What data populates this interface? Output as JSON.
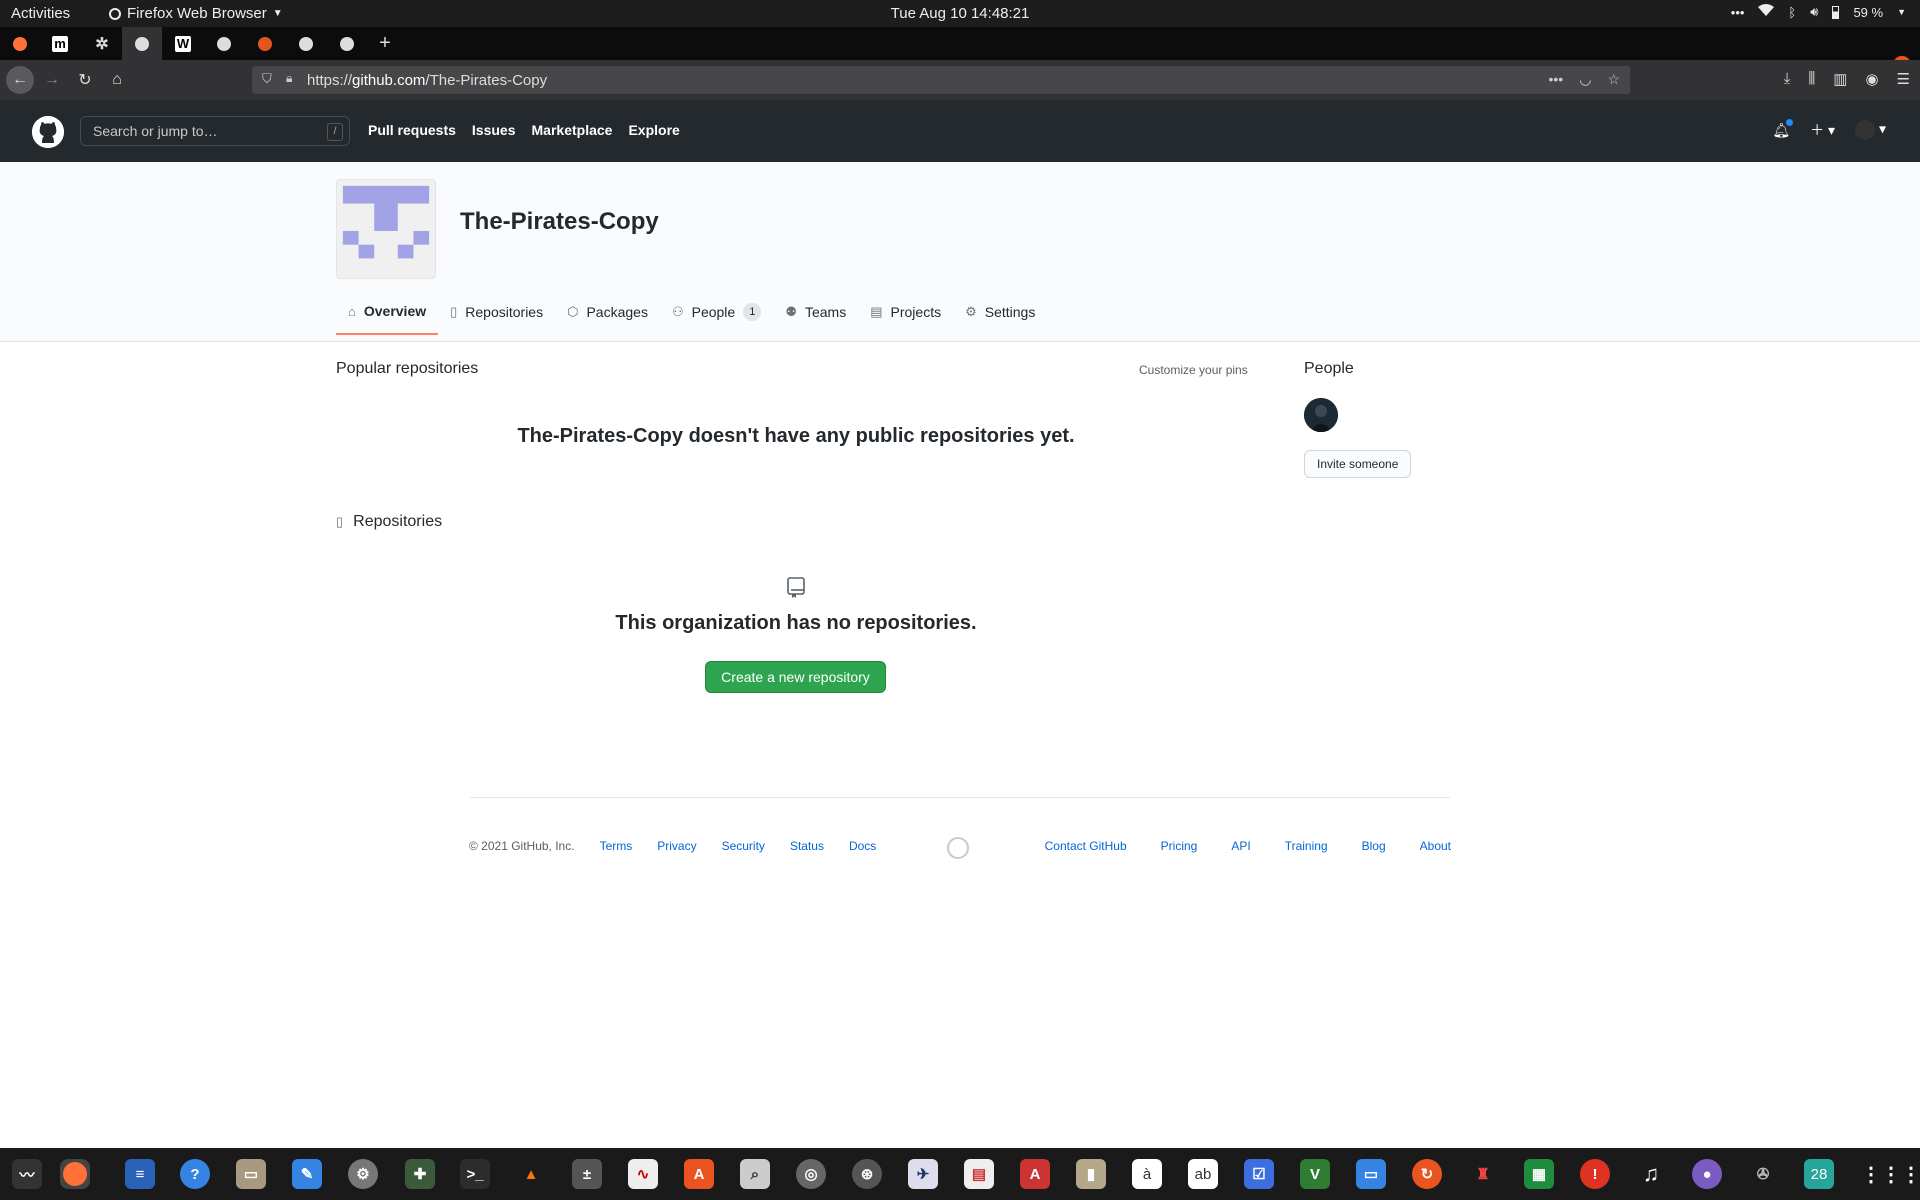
{
  "os": {
    "activities": "Activities",
    "app_name": "Firefox Web Browser",
    "clock": "Tue Aug 10  14:48:21",
    "battery": "59 %"
  },
  "browser": {
    "url_prefix": "https://",
    "url_domain": "github.com",
    "url_path": "/The-Pirates-Copy"
  },
  "github_header": {
    "search_placeholder": "Search or jump to…",
    "search_shortcut": "/",
    "nav": [
      "Pull requests",
      "Issues",
      "Marketplace",
      "Explore"
    ]
  },
  "org": {
    "name": "The-Pirates-Copy",
    "tabs": [
      {
        "label": "Overview",
        "icon": "home-icon"
      },
      {
        "label": "Repositories",
        "icon": "repo-icon"
      },
      {
        "label": "Packages",
        "icon": "package-icon"
      },
      {
        "label": "People",
        "icon": "person-icon",
        "count": "1"
      },
      {
        "label": "Teams",
        "icon": "people-icon"
      },
      {
        "label": "Projects",
        "icon": "project-icon"
      },
      {
        "label": "Settings",
        "icon": "gear-icon"
      }
    ]
  },
  "main": {
    "popular_title": "Popular repositories",
    "customize_pins": "Customize your pins",
    "no_public_repos": "The-Pirates-Copy doesn't have any public repositories yet.",
    "repositories_title": "Repositories",
    "no_repos": "This organization has no repositories.",
    "create_repo": "Create a new repository"
  },
  "sidebar": {
    "people_title": "People",
    "invite": "Invite someone"
  },
  "footer": {
    "copyright": "© 2021 GitHub, Inc.",
    "left_links": [
      "Terms",
      "Privacy",
      "Security",
      "Status",
      "Docs"
    ],
    "right_links": [
      "Contact GitHub",
      "Pricing",
      "API",
      "Training",
      "Blog",
      "About"
    ]
  },
  "dock": {
    "calendar_day": "28"
  },
  "colors": {
    "accent_tab": "#f9826c",
    "create_button": "#2ea44f",
    "link": "#0366d6",
    "avatar_identicon": "#a2a2e6"
  }
}
